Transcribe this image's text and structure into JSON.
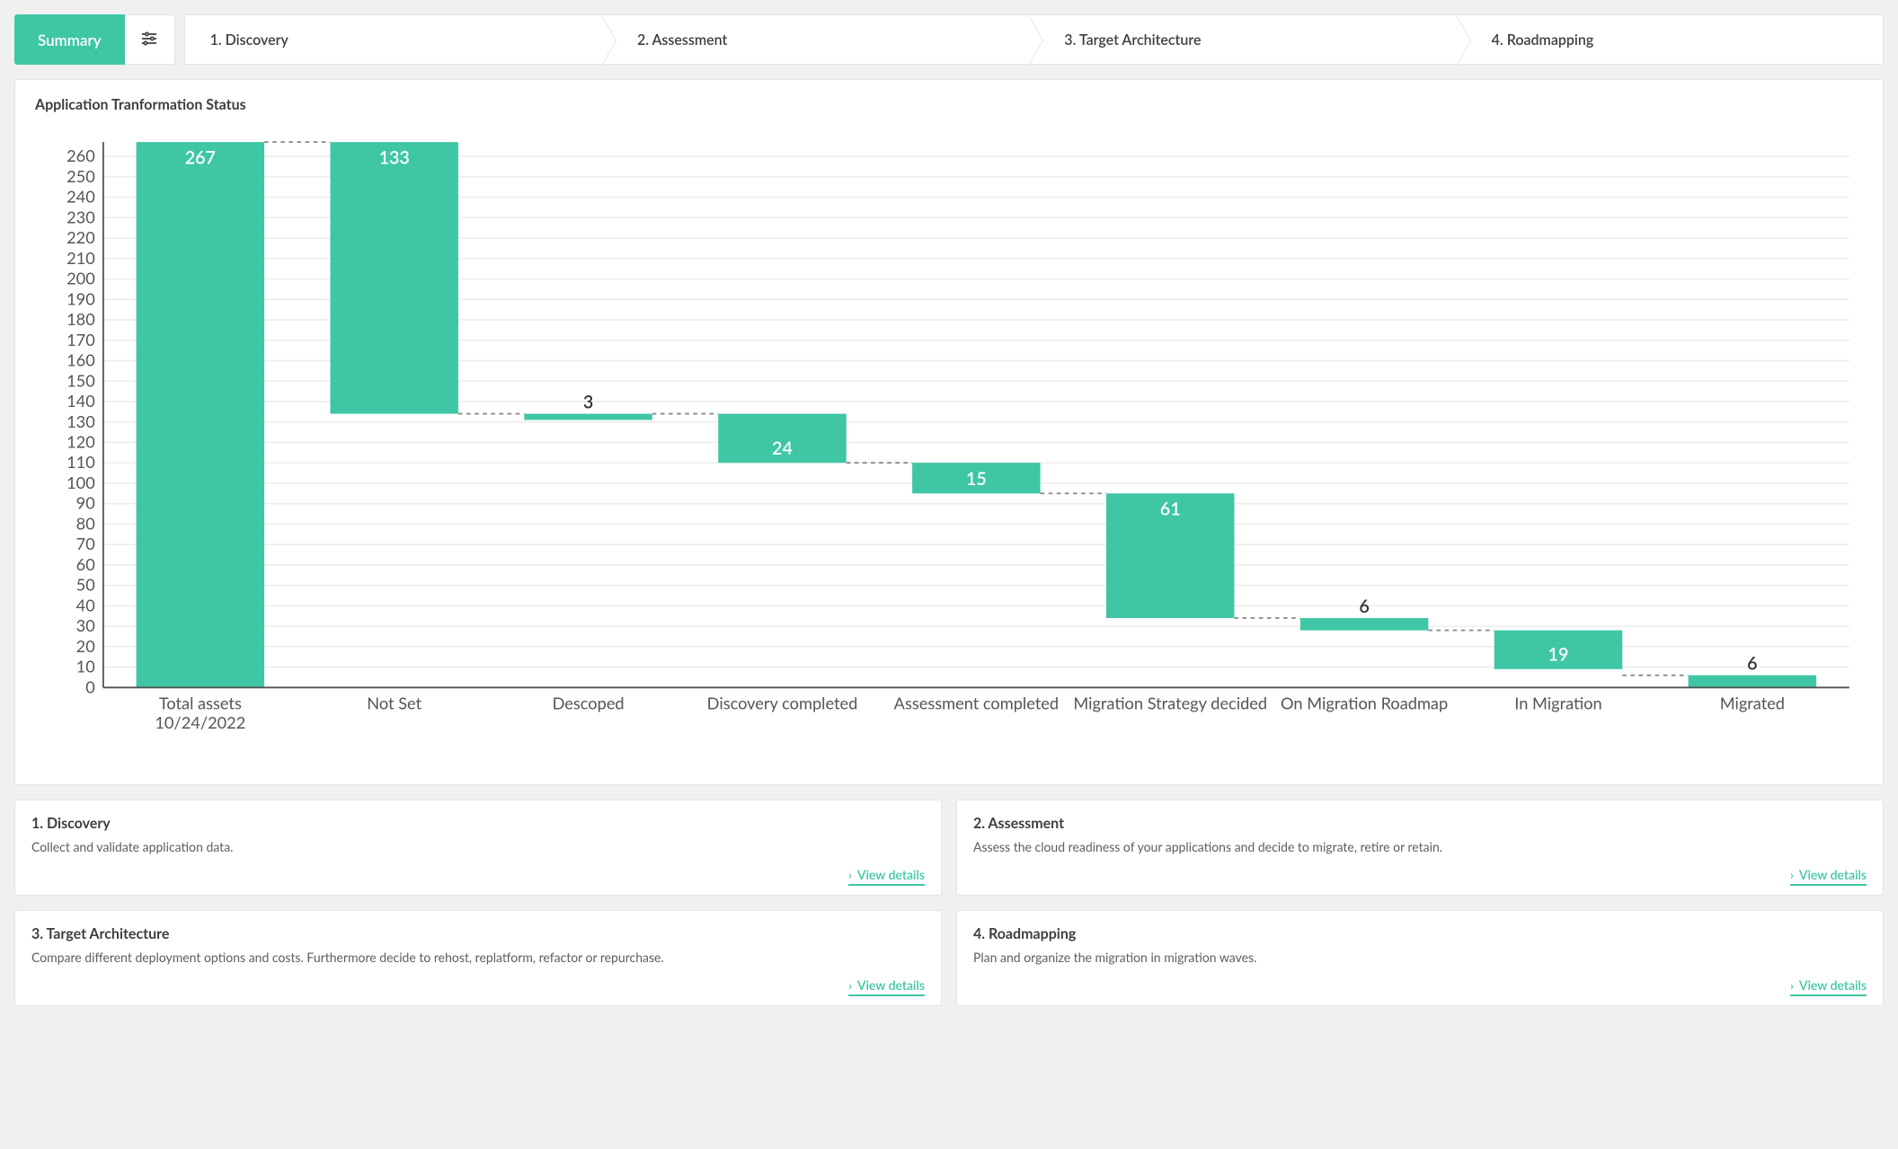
{
  "tabs": {
    "summary": "Summary",
    "steps": [
      "1. Discovery",
      "2. Assessment",
      "3. Target Architecture",
      "4. Roadmapping"
    ]
  },
  "chart_title": "Application Tranformation Status",
  "view_details_label": "View details",
  "chart_data": {
    "type": "bar",
    "title": "Application Tranformation Status",
    "xlabel": "",
    "ylabel": "",
    "ylim": [
      0,
      260
    ],
    "y_ticks": [
      0,
      10,
      20,
      30,
      40,
      50,
      60,
      70,
      80,
      90,
      100,
      110,
      120,
      130,
      140,
      150,
      160,
      170,
      180,
      190,
      200,
      210,
      220,
      230,
      240,
      250,
      260
    ],
    "categories": [
      "Total assets\n10/24/2022",
      "Not Set",
      "Descoped",
      "Discovery completed",
      "Assessment completed",
      "Migration Strategy decided",
      "On Migration Roadmap",
      "In Migration",
      "Migrated"
    ],
    "values": [
      267,
      133,
      3,
      24,
      15,
      61,
      6,
      19,
      6
    ],
    "is_waterfall": true,
    "waterfall_baselines": [
      0,
      134,
      131,
      110,
      95,
      34,
      28,
      9,
      0
    ]
  },
  "cards": [
    {
      "title": "1. Discovery",
      "desc": "Collect and validate application data."
    },
    {
      "title": "2. Assessment",
      "desc": "Assess the cloud readiness of your applications and decide to migrate, retire or retain."
    },
    {
      "title": "3. Target Architecture",
      "desc": "Compare different deployment options and costs. Furthermore decide to rehost, replatform, refactor or repurchase."
    },
    {
      "title": "4. Roadmapping",
      "desc": "Plan and organize the migration in migration waves."
    }
  ],
  "colors": {
    "accent": "#3fc6a5"
  }
}
